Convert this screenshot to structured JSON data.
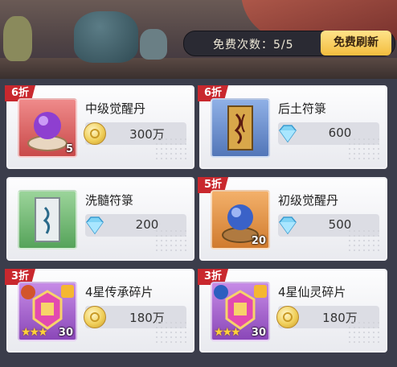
{
  "header": {
    "free_count_label": "免费次数：5/5",
    "refresh_button": "免费刷新"
  },
  "colors": {
    "tag_red": "#c9282e",
    "refresh_yellow": "#f3bd3e",
    "card_bg": "#f4f4f7"
  },
  "items": [
    {
      "discount": "6折",
      "name": "中级觉醒丹",
      "price": "300万",
      "currency": "gold-coin-icon",
      "count": "5",
      "icon": "purple-orb-icon"
    },
    {
      "discount": "6折",
      "name": "后土符箓",
      "price": "600",
      "currency": "diamond-icon",
      "count": "",
      "icon": "talisman-icon"
    },
    {
      "discount": "",
      "name": "洗髓符箓",
      "price": "200",
      "currency": "diamond-icon",
      "count": "",
      "icon": "scroll-icon"
    },
    {
      "discount": "5折",
      "name": "初级觉醒丹",
      "price": "500",
      "currency": "diamond-icon",
      "count": "20",
      "icon": "blue-orb-icon"
    },
    {
      "discount": "3折",
      "name": "4星传承碎片",
      "price": "180万",
      "currency": "gold-coin-icon",
      "count": "30",
      "icon": "shard-icon",
      "stars": "★★★"
    },
    {
      "discount": "3折",
      "name": "4星仙灵碎片",
      "price": "180万",
      "currency": "gold-coin-icon",
      "count": "30",
      "icon": "shard-icon",
      "stars": "★★★"
    }
  ]
}
